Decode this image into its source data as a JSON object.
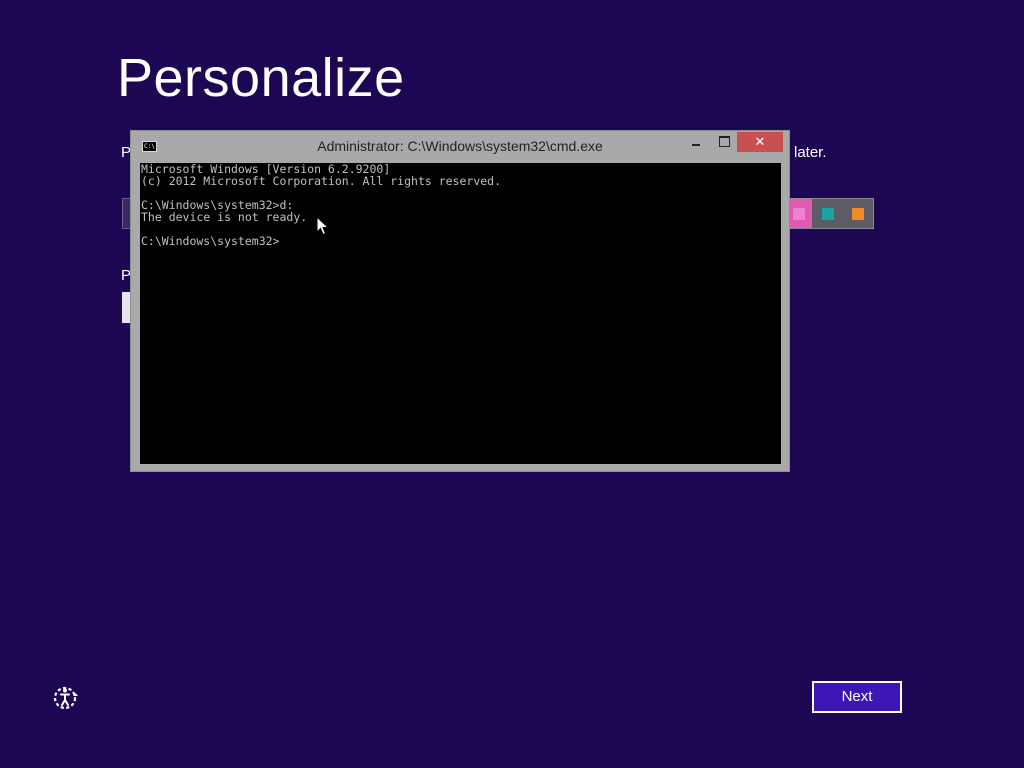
{
  "page": {
    "title": "Personalize",
    "background_color": "#1e0752"
  },
  "background_fragments": {
    "left_letter_1": "P",
    "right_text_1": "later.",
    "left_letter_2": "P"
  },
  "color_picker": {
    "visible_swatches": [
      "#ee82cf",
      "#1aa3a3",
      "#f08a24"
    ]
  },
  "cmd_window": {
    "title": "Administrator: C:\\Windows\\system32\\cmd.exe",
    "icon": "cmd-icon",
    "icon_text": "C:\\",
    "buttons": {
      "minimize": "minimize-icon",
      "maximize": "maximize-icon",
      "close": "close-icon",
      "close_glyph": "✕"
    },
    "lines": [
      "Microsoft Windows [Version 6.2.9200]",
      "(c) 2012 Microsoft Corporation. All rights reserved.",
      "",
      "C:\\Windows\\system32>d:",
      "The device is not ready.",
      "",
      "C:\\Windows\\system32>"
    ]
  },
  "footer": {
    "ease_of_access_icon": "ease-of-access-icon",
    "next_label": "Next"
  }
}
